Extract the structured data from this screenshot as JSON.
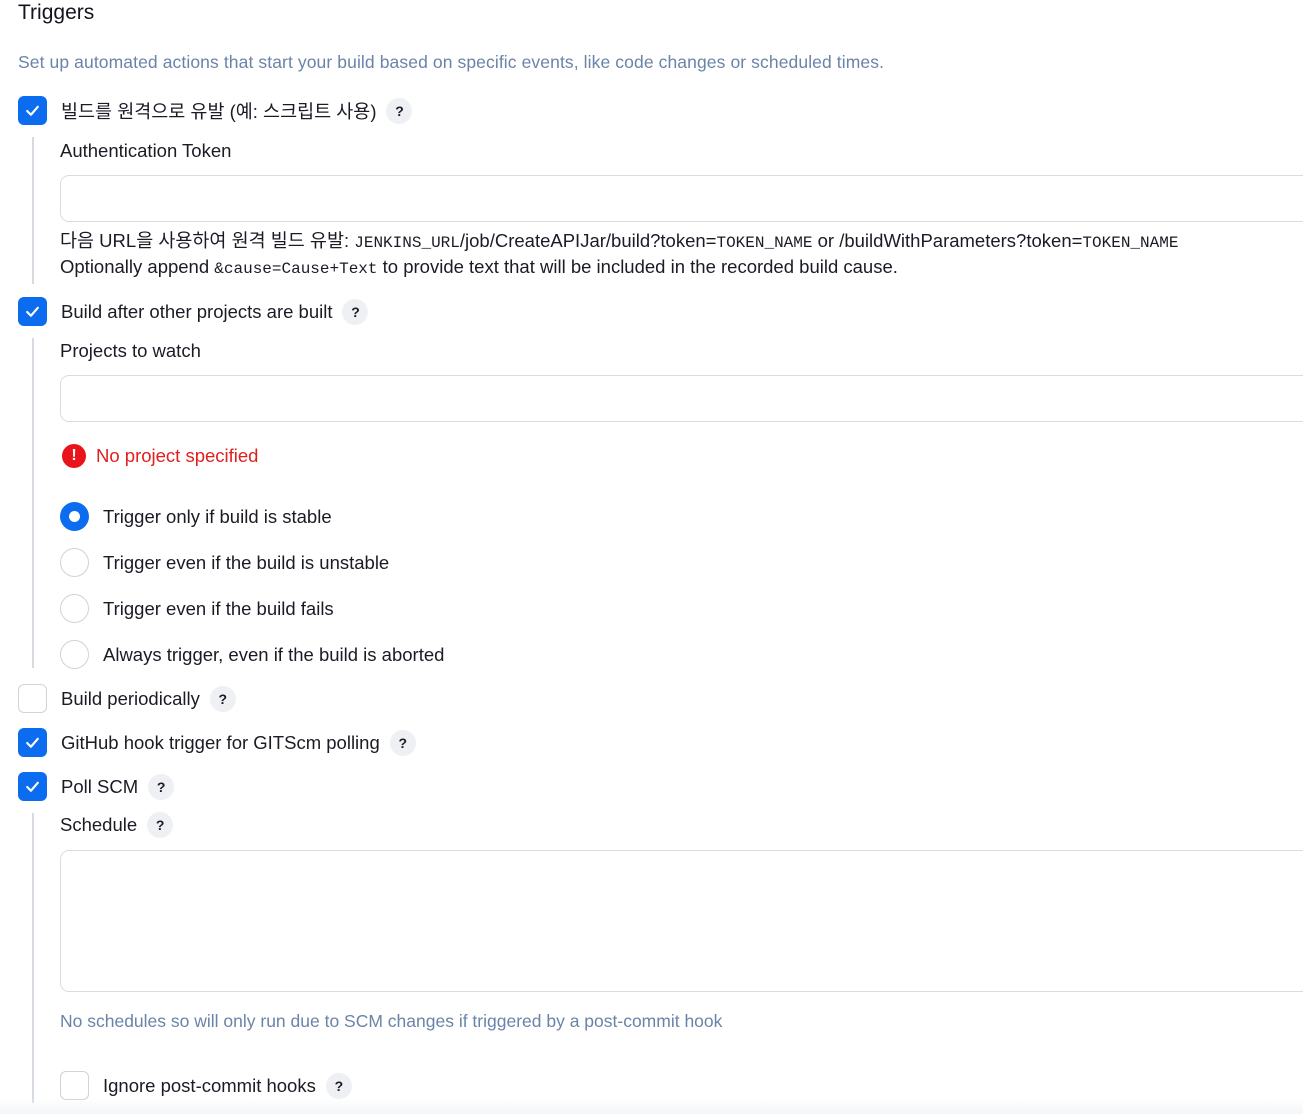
{
  "section": {
    "title": "Triggers",
    "description": "Set up automated actions that start your build based on specific events, like code changes or scheduled times."
  },
  "help_glyph": "?",
  "colors": {
    "accent": "#0b6cf0",
    "error": "#e8141a",
    "hint": "#6a84a8"
  },
  "remote_trigger": {
    "label": "빌드를 원격으로 유발 (예: 스크립트 사용)",
    "checked": true,
    "token_label": "Authentication Token",
    "token_value": "",
    "url_prefix": "다음 URL을 사용하여 원격 빌드 유발: ",
    "url_code1": "JENKINS_URL",
    "url_path": "/job/CreateAPIJar/build?token=",
    "url_code2": "TOKEN_NAME",
    "url_or": " or /buildWithParameters?token=",
    "url_code3": "TOKEN_NAME",
    "cause_prefix": "Optionally append ",
    "cause_code": "&cause=Cause+Text",
    "cause_suffix": " to provide text that will be included in the recorded build cause."
  },
  "after_other": {
    "label": "Build after other projects are built",
    "checked": true,
    "projects_label": "Projects to watch",
    "projects_value": "",
    "error_icon": "!",
    "error": "No project specified",
    "options": [
      {
        "label": "Trigger only if build is stable",
        "selected": true
      },
      {
        "label": "Trigger even if the build is unstable",
        "selected": false
      },
      {
        "label": "Trigger even if the build fails",
        "selected": false
      },
      {
        "label": "Always trigger, even if the build is aborted",
        "selected": false
      }
    ]
  },
  "build_periodically": {
    "label": "Build periodically",
    "checked": false
  },
  "github_hook": {
    "label": "GitHub hook trigger for GITScm polling",
    "checked": true
  },
  "poll_scm": {
    "label": "Poll SCM",
    "checked": true,
    "schedule_label": "Schedule",
    "schedule_value": "",
    "hint": "No schedules so will only run due to SCM changes if triggered by a post-commit hook",
    "ignore_label": "Ignore post-commit hooks",
    "ignore_checked": false
  }
}
